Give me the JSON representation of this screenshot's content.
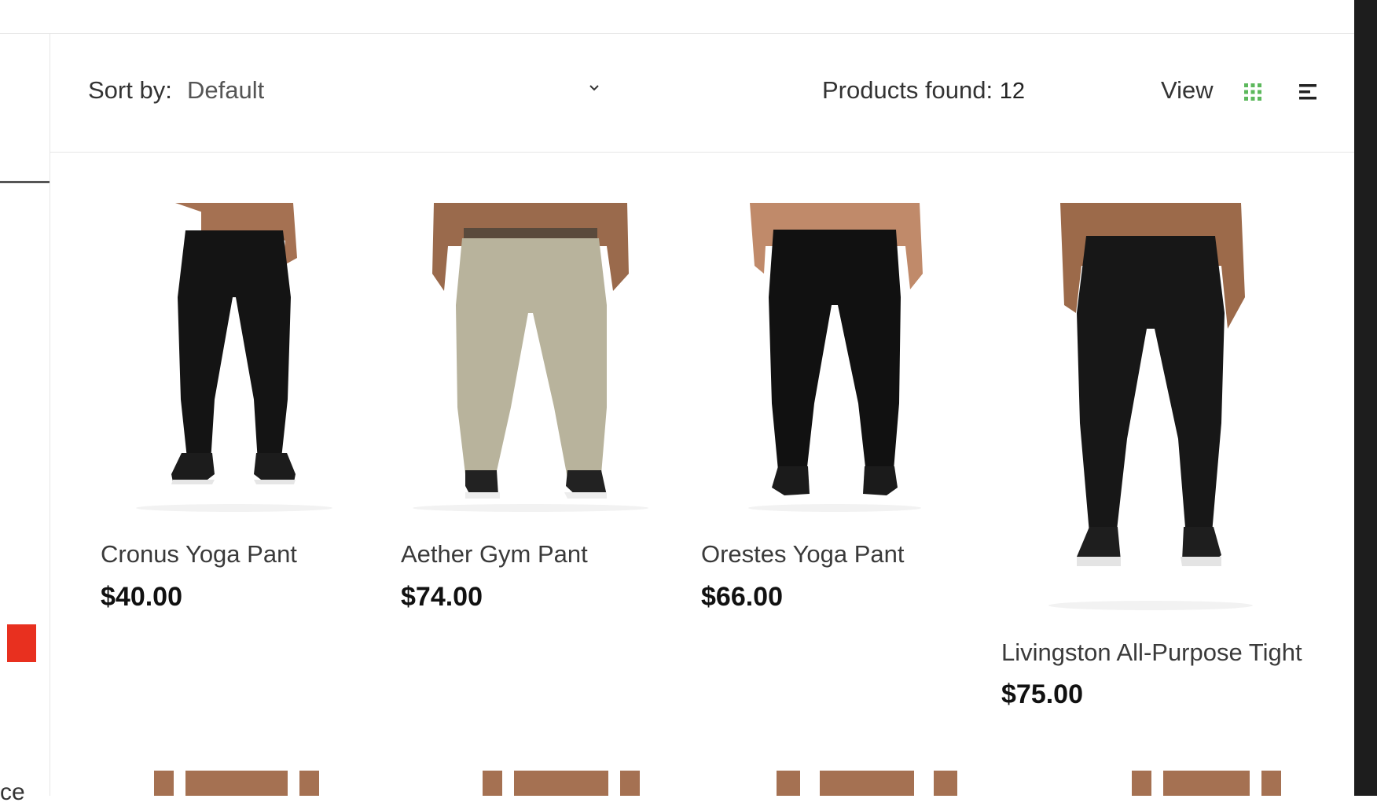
{
  "toolbar": {
    "sort_label": "Sort by:",
    "sort_value": "Default",
    "products_found_label": "Products found:",
    "products_found_count": "12",
    "view_label": "View",
    "accent_color": "#5cb85c"
  },
  "sidebar": {
    "partial_text": "ce",
    "swatch_color": "#e8301f"
  },
  "products": [
    {
      "name": "Cronus Yoga Pant",
      "price": "$40.00",
      "image": "black-yoga-pant"
    },
    {
      "name": "Aether Gym Pant",
      "price": "$74.00",
      "image": "khaki-cargo-pant"
    },
    {
      "name": "Orestes Yoga Pant",
      "price": "$66.00",
      "image": "black-yoga-pant"
    },
    {
      "name": "Livingston All-Purpose Tight",
      "price": "$75.00",
      "image": "black-tight"
    }
  ]
}
